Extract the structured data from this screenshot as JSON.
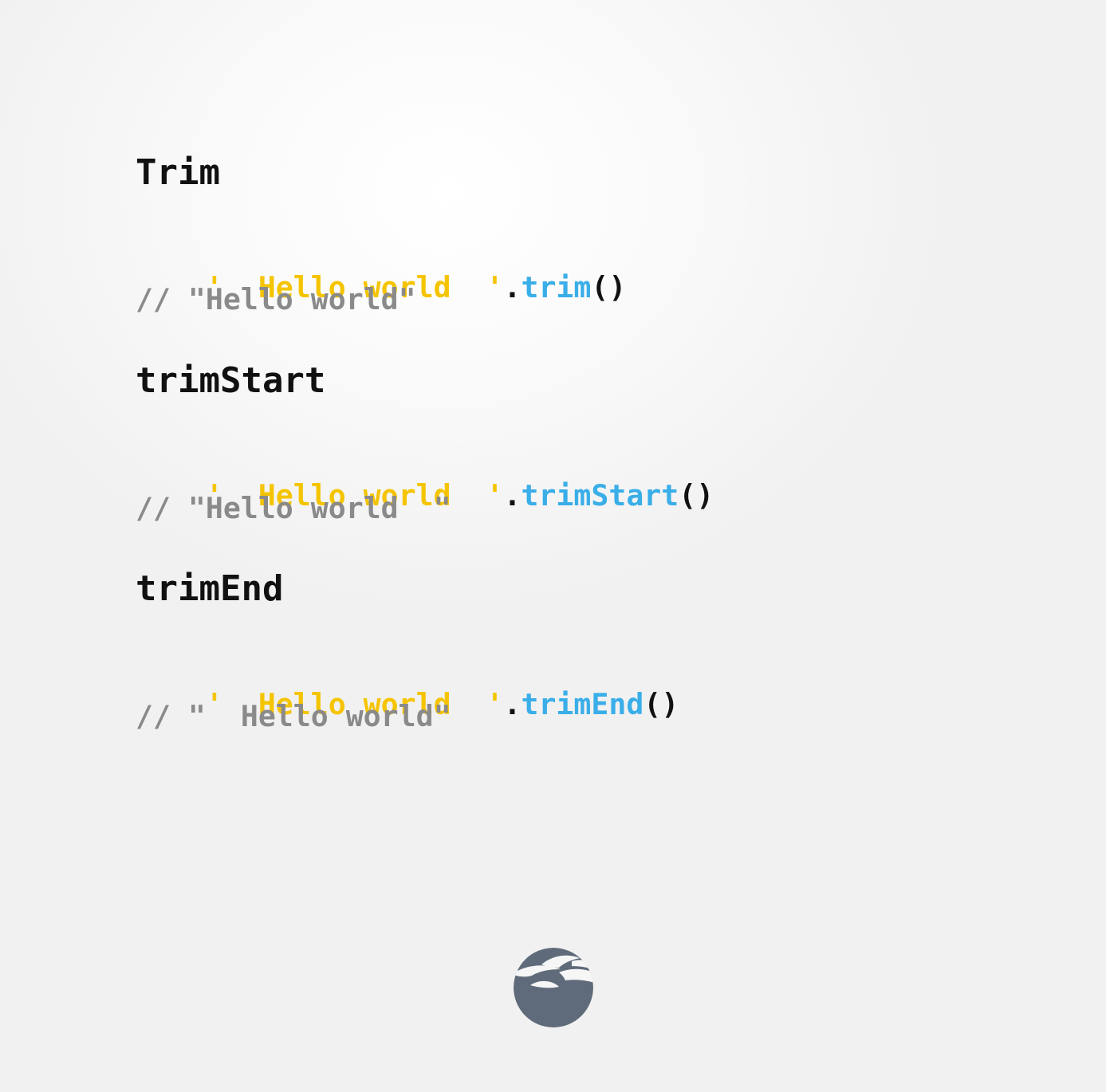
{
  "sections": [
    {
      "heading": "Trim",
      "code": {
        "string": "'  Hello world  '",
        "dot": ".",
        "method": "trim",
        "parens": "()"
      },
      "comment": "// \"Hello world\""
    },
    {
      "heading": "trimStart",
      "code": {
        "string": "'  Hello world  '",
        "dot": ".",
        "method": "trimStart",
        "parens": "()"
      },
      "comment": "// \"Hello world  \""
    },
    {
      "heading": "trimEnd",
      "code": {
        "string": "'  Hello world  '",
        "dot": ".",
        "method": "trimEnd",
        "parens": "()"
      },
      "comment": "// \"  Hello world\""
    }
  ],
  "colors": {
    "string": "#f5c400",
    "method": "#3aaee8",
    "comment": "#8a8a8a",
    "heading": "#111111",
    "logo": "#5f6b7a"
  },
  "logo": {
    "icon": "leaf-moon-logo-icon"
  }
}
